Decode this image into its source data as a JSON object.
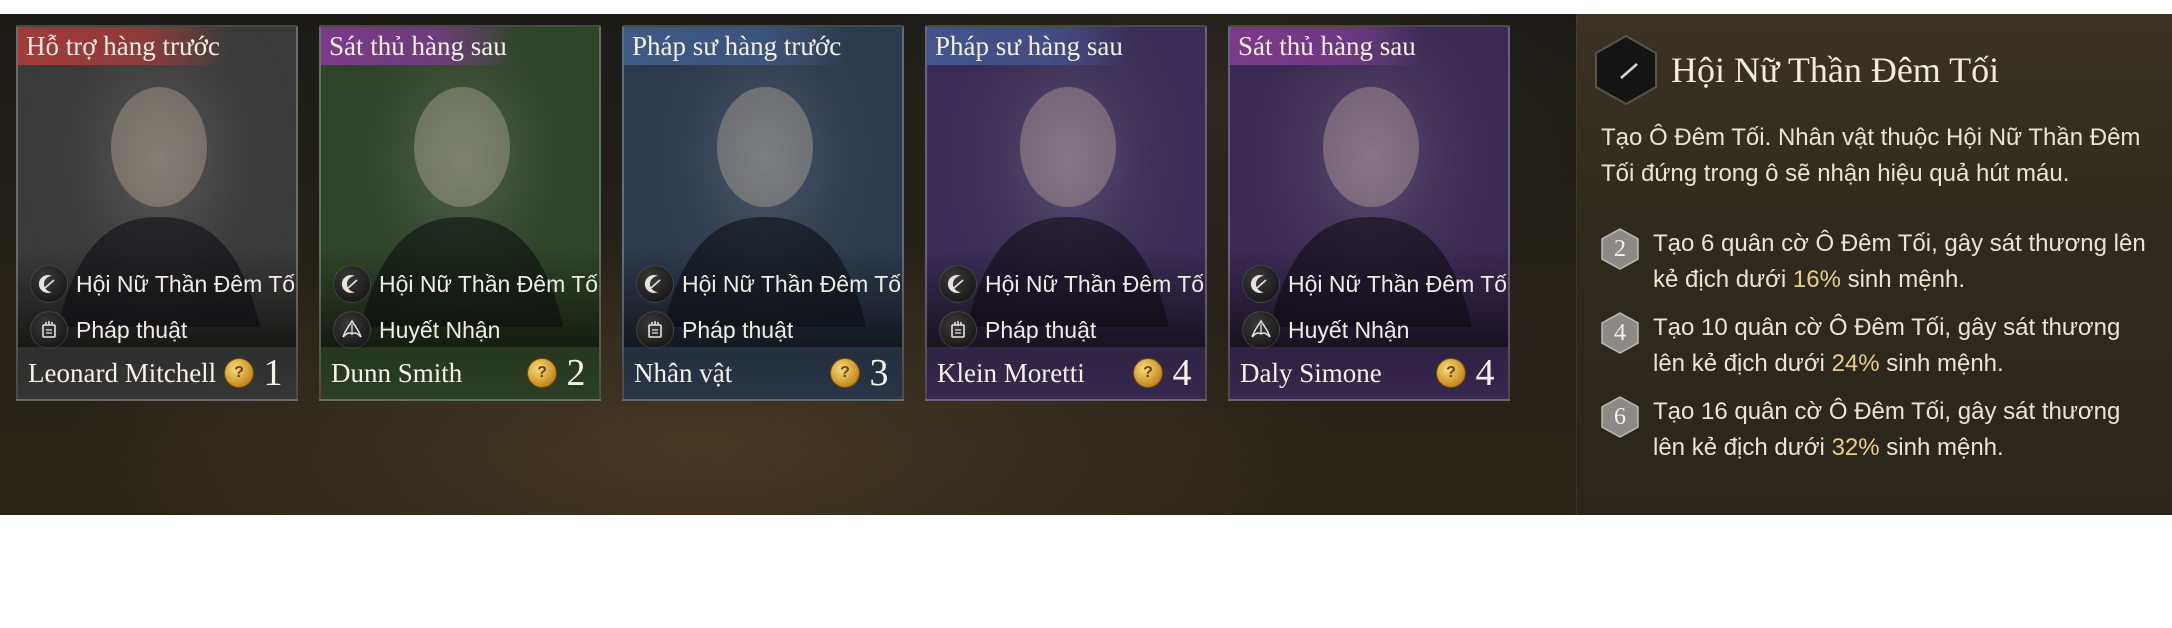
{
  "cards": [
    {
      "role": "Hỗ trợ hàng trước",
      "role_color": "#a23a3a",
      "theme_color": "#3a3a3a",
      "traits": [
        {
          "icon": "crescent-moon-icon",
          "label": "Hội Nữ Thần Đêm Tối"
        },
        {
          "icon": "magic-tome-icon",
          "label": "Pháp thuật"
        }
      ],
      "name": "Leonard Mitchell",
      "cost": "1"
    },
    {
      "role": "Sát thủ hàng sau",
      "role_color": "#7b3a8c",
      "theme_color": "#2f4428",
      "traits": [
        {
          "icon": "crescent-moon-icon",
          "label": "Hội Nữ Thần Đêm Tối"
        },
        {
          "icon": "blood-blade-icon",
          "label": "Huyết Nhận"
        }
      ],
      "name": "Dunn Smith",
      "cost": "2"
    },
    {
      "role": "Pháp sư hàng trước",
      "role_color": "#3e5a86",
      "theme_color": "#2c3a4e",
      "traits": [
        {
          "icon": "crescent-moon-icon",
          "label": "Hội Nữ Thần Đêm Tối"
        },
        {
          "icon": "magic-tome-icon",
          "label": "Pháp thuật"
        }
      ],
      "name": "Nhân vật",
      "cost": "3"
    },
    {
      "role": "Pháp sư hàng sau",
      "role_color": "#43548f",
      "theme_color": "#3a2c57",
      "traits": [
        {
          "icon": "crescent-moon-icon",
          "label": "Hội Nữ Thần Đêm Tối"
        },
        {
          "icon": "magic-tome-icon",
          "label": "Pháp thuật"
        }
      ],
      "name": "Klein Moretti",
      "cost": "4"
    },
    {
      "role": "Sát thủ hàng sau",
      "role_color": "#7b3a8c",
      "theme_color": "#3b2a55",
      "traits": [
        {
          "icon": "crescent-moon-icon",
          "label": "Hội Nữ Thần Đêm Tối"
        },
        {
          "icon": "blood-blade-icon",
          "label": "Huyết Nhận"
        }
      ],
      "name": "Daly Simone",
      "cost": "4"
    }
  ],
  "panel": {
    "icon": "crescent-moon-icon",
    "title": "Hội Nữ Thần Đêm Tối",
    "description": "Tạo Ô Đêm Tối. Nhân vật thuộc Hội Nữ Thần Đêm Tối đứng trong ô sẽ nhận hiệu quả hút máu.",
    "tiers": [
      {
        "level": "2",
        "text_before": "Tạo 6 quân cờ Ô Đêm Tối, gây sát thương lên kẻ địch dưới ",
        "pct": "16%",
        "text_after": " sinh mệnh."
      },
      {
        "level": "4",
        "text_before": "Tạo 10 quân cờ Ô Đêm Tối, gây sát thương lên kẻ địch dưới ",
        "pct": "24%",
        "text_after": " sinh mệnh."
      },
      {
        "level": "6",
        "text_before": "Tạo 16 quân cờ Ô Đêm Tối, gây sát thương lên kẻ địch dưới ",
        "pct": "32%",
        "text_after": " sinh mệnh."
      }
    ]
  },
  "colors": {
    "accent_gold": "#e8cf86",
    "coin_gold": "#d9a233"
  }
}
